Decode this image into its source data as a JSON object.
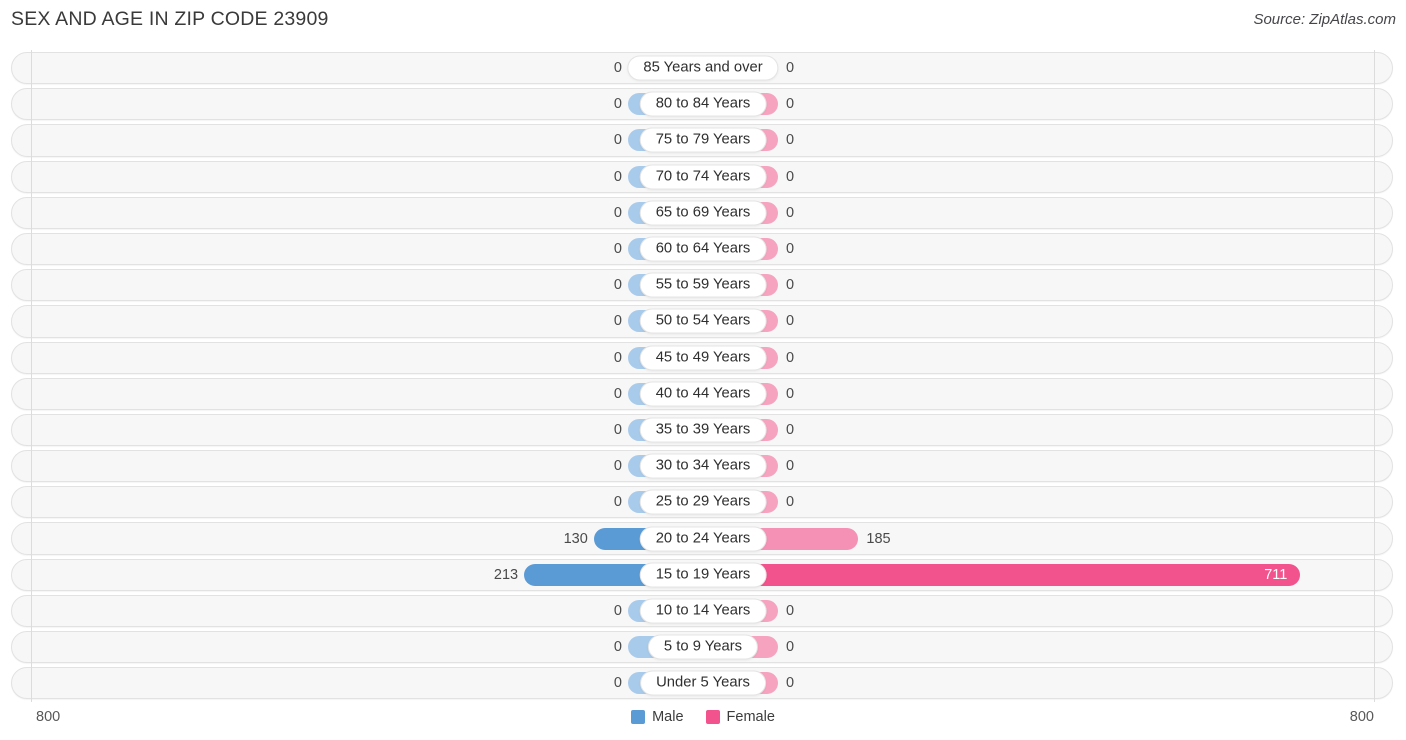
{
  "header": {
    "title": "SEX AND AGE IN ZIP CODE 23909",
    "source": "Source: ZipAtlas.com"
  },
  "legend": {
    "male_label": "Male",
    "female_label": "Female",
    "male_color": "#5b9bd5",
    "female_color": "#f2538c"
  },
  "axis": {
    "left_tick": "800",
    "right_tick": "800",
    "max": 800
  },
  "chart_data": {
    "type": "bar",
    "subtype": "population-pyramid",
    "title": "SEX AND AGE IN ZIP CODE 23909",
    "xlabel": "",
    "ylabel": "",
    "xlim": [
      800,
      800
    ],
    "grid": false,
    "legend_position": "bottom-center",
    "categories": [
      "85 Years and over",
      "80 to 84 Years",
      "75 to 79 Years",
      "70 to 74 Years",
      "65 to 69 Years",
      "60 to 64 Years",
      "55 to 59 Years",
      "50 to 54 Years",
      "45 to 49 Years",
      "40 to 44 Years",
      "35 to 39 Years",
      "30 to 34 Years",
      "25 to 29 Years",
      "20 to 24 Years",
      "15 to 19 Years",
      "10 to 14 Years",
      "5 to 9 Years",
      "Under 5 Years"
    ],
    "series": [
      {
        "name": "Male",
        "values": [
          0,
          0,
          0,
          0,
          0,
          0,
          0,
          0,
          0,
          0,
          0,
          0,
          0,
          130,
          213,
          0,
          0,
          0
        ]
      },
      {
        "name": "Female",
        "values": [
          0,
          0,
          0,
          0,
          0,
          0,
          0,
          0,
          0,
          0,
          0,
          0,
          0,
          185,
          711,
          0,
          0,
          0
        ]
      }
    ]
  },
  "rows": [
    {
      "label": "85 Years and over",
      "male": "0",
      "female": "0"
    },
    {
      "label": "80 to 84 Years",
      "male": "0",
      "female": "0"
    },
    {
      "label": "75 to 79 Years",
      "male": "0",
      "female": "0"
    },
    {
      "label": "70 to 74 Years",
      "male": "0",
      "female": "0"
    },
    {
      "label": "65 to 69 Years",
      "male": "0",
      "female": "0"
    },
    {
      "label": "60 to 64 Years",
      "male": "0",
      "female": "0"
    },
    {
      "label": "55 to 59 Years",
      "male": "0",
      "female": "0"
    },
    {
      "label": "50 to 54 Years",
      "male": "0",
      "female": "0"
    },
    {
      "label": "45 to 49 Years",
      "male": "0",
      "female": "0"
    },
    {
      "label": "40 to 44 Years",
      "male": "0",
      "female": "0"
    },
    {
      "label": "35 to 39 Years",
      "male": "0",
      "female": "0"
    },
    {
      "label": "30 to 34 Years",
      "male": "0",
      "female": "0"
    },
    {
      "label": "25 to 29 Years",
      "male": "0",
      "female": "0"
    },
    {
      "label": "20 to 24 Years",
      "male": "130",
      "female": "185"
    },
    {
      "label": "15 to 19 Years",
      "male": "213",
      "female": "711"
    },
    {
      "label": "10 to 14 Years",
      "male": "0",
      "female": "0"
    },
    {
      "label": "5 to 9 Years",
      "male": "0",
      "female": "0"
    },
    {
      "label": "Under 5 Years",
      "male": "0",
      "female": "0"
    }
  ]
}
